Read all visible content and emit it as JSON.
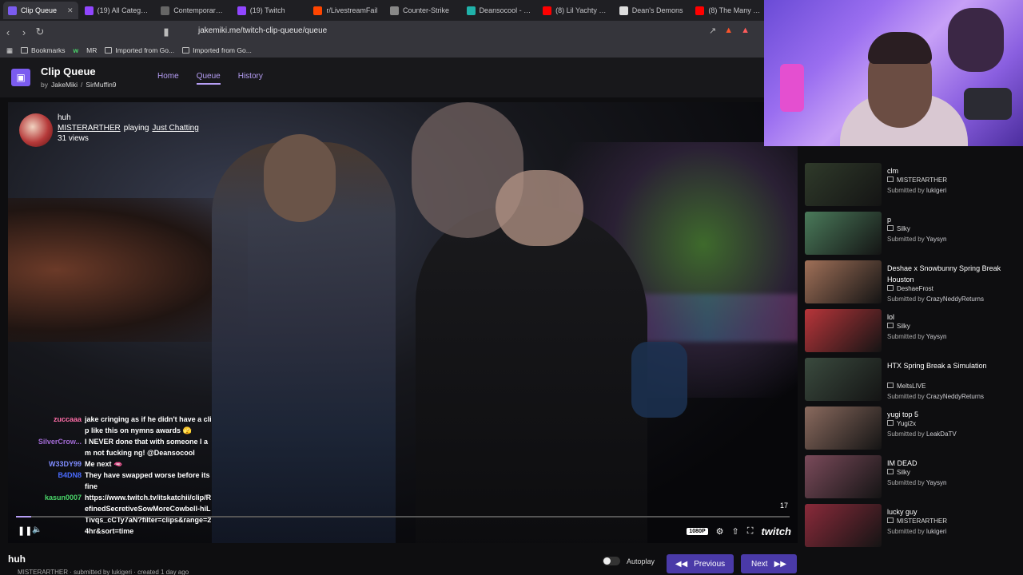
{
  "browser": {
    "tabs": [
      {
        "label": "Clip Queue",
        "active": true,
        "favicon": "#7b5cf0"
      },
      {
        "label": "(19) All Categories",
        "active": false,
        "favicon": "#9146ff"
      },
      {
        "label": "Contemporary M",
        "active": false,
        "favicon": "#666666"
      },
      {
        "label": "(19) Twitch",
        "active": false,
        "favicon": "#9146ff"
      },
      {
        "label": "r/LivestreamFail",
        "active": false,
        "favicon": "#ff4500"
      },
      {
        "label": "Counter-Strike",
        "active": false,
        "favicon": "#888888"
      },
      {
        "label": "Deansocool - Stre",
        "active": false,
        "favicon": "#20b2aa"
      },
      {
        "label": "(8) Lil Yachty - W",
        "active": false,
        "favicon": "#ff0000"
      },
      {
        "label": "Dean's Demons",
        "active": false,
        "favicon": "#dddddd"
      },
      {
        "label": "(8) The Many Mu",
        "active": false,
        "favicon": "#ff0000"
      }
    ],
    "url": "jakemiki.me/twitch-clip-queue/queue",
    "bookmarks": [
      "Bookmarks",
      "w",
      "MR",
      "Imported from Go...",
      "Imported from Go..."
    ]
  },
  "app": {
    "title": "Clip Queue",
    "by_prefix": "by",
    "author1": "JakeMiki",
    "separator": "/",
    "author2": "SirMuffin9",
    "nav": {
      "home": "Home",
      "queue": "Queue",
      "history": "History"
    }
  },
  "clip": {
    "title": "huh",
    "channel": "MISTERARTHER",
    "playing": "playing",
    "game": "Just Chatting",
    "views": "31 views",
    "viewer_count": "17",
    "quality": "1080P",
    "logo": "twitch",
    "progress": 0.02,
    "below_title": "huh",
    "below_sub": "MISTERARTHER  · submitted by lukigeri  · created 1 day ago"
  },
  "chat": [
    {
      "user": "zuccaaa",
      "color": "#ff6ea8",
      "text": "jake cringing as if he didn't have a clip like this on nymns awards 🫣"
    },
    {
      "user": "SilverCrow...",
      "color": "#a36bd6",
      "text": "I NEVER done that with someone I am not fucking ng! @Deansocool"
    },
    {
      "user": "W33DY99",
      "color": "#7f8cff",
      "text": "Me next 🫦"
    },
    {
      "user": "B4DN8",
      "color": "#4a6bff",
      "text": "They have swapped worse before its fine"
    },
    {
      "user": "kasun0007",
      "color": "#4ad66a",
      "text": "https://www.twitch.tv/itskatchii/clip/RefinedSecretiveSowMoreCowbell-hiLTivqs_cCTy7aN?filter=clips&range=24hr&sort=time"
    }
  ],
  "controls": {
    "autoplay": "Autoplay",
    "previous": "Previous",
    "next": "Next"
  },
  "queue": [
    {
      "title": "clm",
      "author": "MISTERARTHER",
      "submitted_prefix": "Submitted by",
      "submitter": "lukigeri",
      "thumb": "#2f3a2a"
    },
    {
      "title": "p",
      "author": "Silky",
      "submitted_prefix": "Submitted by",
      "submitter": "Yaysyn",
      "thumb": "#4a7a5a"
    },
    {
      "title": "Deshae x Snowbunny Spring Break Houston",
      "author": "DeshaeFrost",
      "submitted_prefix": "Submitted by",
      "submitter": "CrazyNeddyReturns",
      "thumb": "#a07058"
    },
    {
      "title": "lol",
      "author": "Silky",
      "submitted_prefix": "Submitted by",
      "submitter": "Yaysyn",
      "thumb": "#b8353a"
    },
    {
      "title": "HTX Spring Break a Simulation",
      "author": "MeltsLIVE",
      "submitted_prefix": "Submitted by",
      "submitter": "CrazyNeddyReturns",
      "thumb": "#3a4a3e"
    },
    {
      "title": "yugi top 5",
      "author": "Yugi2x",
      "submitted_prefix": "Submitted by",
      "submitter": "LeakDaTV",
      "thumb": "#8a6a5e"
    },
    {
      "title": "IM DEAD",
      "author": "Silky",
      "submitted_prefix": "Submitted by",
      "submitter": "Yaysyn",
      "thumb": "#7a4a5a"
    },
    {
      "title": "lucky guy",
      "author": "MISTERARTHER",
      "submitted_prefix": "Submitted by",
      "submitter": "lukigeri",
      "thumb": "#8a2a3a"
    }
  ]
}
